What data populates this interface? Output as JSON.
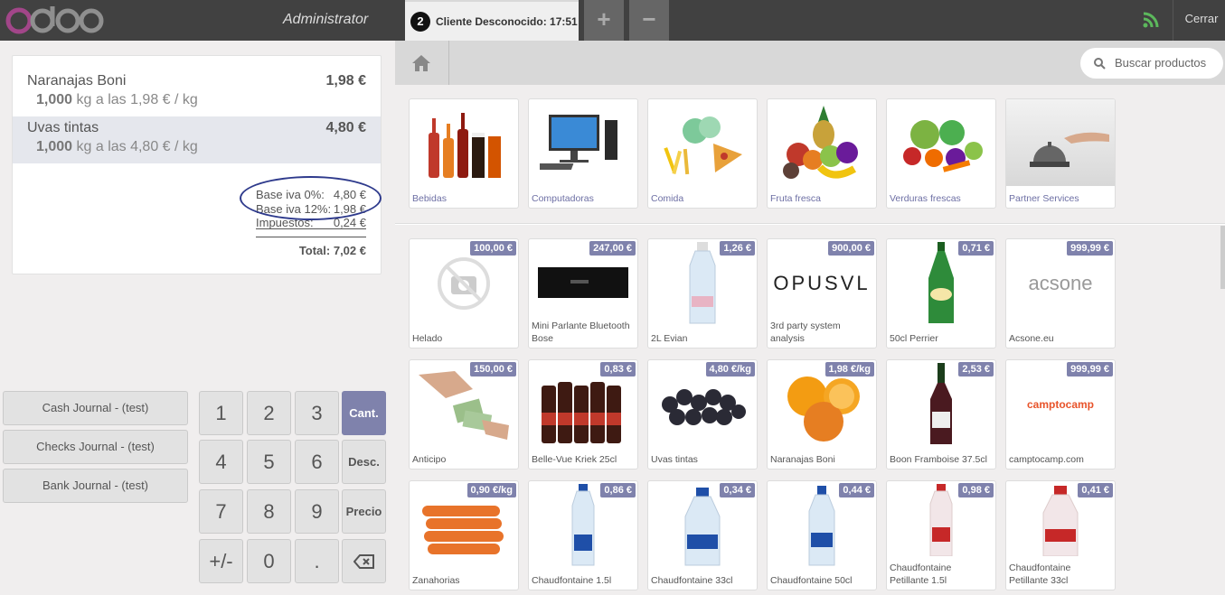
{
  "app": {
    "logo": "odoo",
    "user": "Administrator",
    "close_label": "Cerrar"
  },
  "order": {
    "number": "2",
    "name": "Cliente Desconocido: 17:51",
    "add_icon": "+",
    "remove_icon": "−"
  },
  "orderlines": [
    {
      "name": "Naranajas Boni",
      "price": "1,98 €",
      "qty": "1,000",
      "info": "kg a las 1,98 € / kg"
    },
    {
      "name": "Uvas tintas",
      "price": "4,80 €",
      "qty": "1,000",
      "info": "kg a las 4,80 € / kg"
    }
  ],
  "summary": {
    "tax0_label": "Base iva 0%:",
    "tax0_value": "4,80 €",
    "tax12_label": "Base iva 12%:",
    "tax12_value": "1,98 €",
    "taxes_label": "Impuestos:",
    "taxes_value": "0,24 €",
    "total": "Total: 7,02 €"
  },
  "payment_methods": [
    "Cash Journal - (test)",
    "Checks Journal - (test)",
    "Bank Journal - (test)"
  ],
  "numpad": {
    "digits": [
      "1",
      "2",
      "3",
      "4",
      "5",
      "6",
      "7",
      "8",
      "9",
      "+/-",
      "0",
      "."
    ],
    "modes": [
      "Cant.",
      "Desc.",
      "Precio"
    ],
    "active_mode": "Cant.",
    "backspace_icon": "backspace-icon"
  },
  "search": {
    "placeholder": "Buscar productos"
  },
  "categories": [
    "Bebidas",
    "Computadoras",
    "Comida",
    "Fruta fresca",
    "Verduras frescas",
    "Partner Services"
  ],
  "products": [
    {
      "name": "Helado",
      "price": "100,00 €"
    },
    {
      "name": "Mini Parlante Bluetooth Bose",
      "price": "247,00 €"
    },
    {
      "name": "2L Evian",
      "price": "1,26 €"
    },
    {
      "name": "3rd party system analysis",
      "price": "900,00 €",
      "logo": "OPUSVL"
    },
    {
      "name": "50cl Perrier",
      "price": "0,71 €"
    },
    {
      "name": "Acsone.eu",
      "price": "999,99 €",
      "logo": "acsone"
    },
    {
      "name": "Anticipo",
      "price": "150,00 €"
    },
    {
      "name": "Belle-Vue Kriek 25cl",
      "price": "0,83 €"
    },
    {
      "name": "Uvas tintas",
      "price": "4,80 €/kg"
    },
    {
      "name": "Naranajas Boni",
      "price": "1,98 €/kg"
    },
    {
      "name": "Boon Framboise 37.5cl",
      "price": "2,53 €"
    },
    {
      "name": "camptocamp.com",
      "price": "999,99 €",
      "logo": "camptocamp"
    },
    {
      "name": "Zanahorias",
      "price": "0,90 €/kg"
    },
    {
      "name": "Chaudfontaine 1.5l",
      "price": "0,86 €"
    },
    {
      "name": "Chaudfontaine 33cl",
      "price": "0,34 €"
    },
    {
      "name": "Chaudfontaine 50cl",
      "price": "0,44 €"
    },
    {
      "name": "Chaudfontaine Petillante 1.5l",
      "price": "0,98 €"
    },
    {
      "name": "Chaudfontaine Petillante 33cl",
      "price": "0,41 €"
    }
  ],
  "colors": {
    "topbar": "#414141",
    "accent": "#7f82ac",
    "highlight": "#e5e7ed",
    "logo_o": "#a24689",
    "wifi": "#5cb85c",
    "annotation": "#2e3a8c"
  }
}
